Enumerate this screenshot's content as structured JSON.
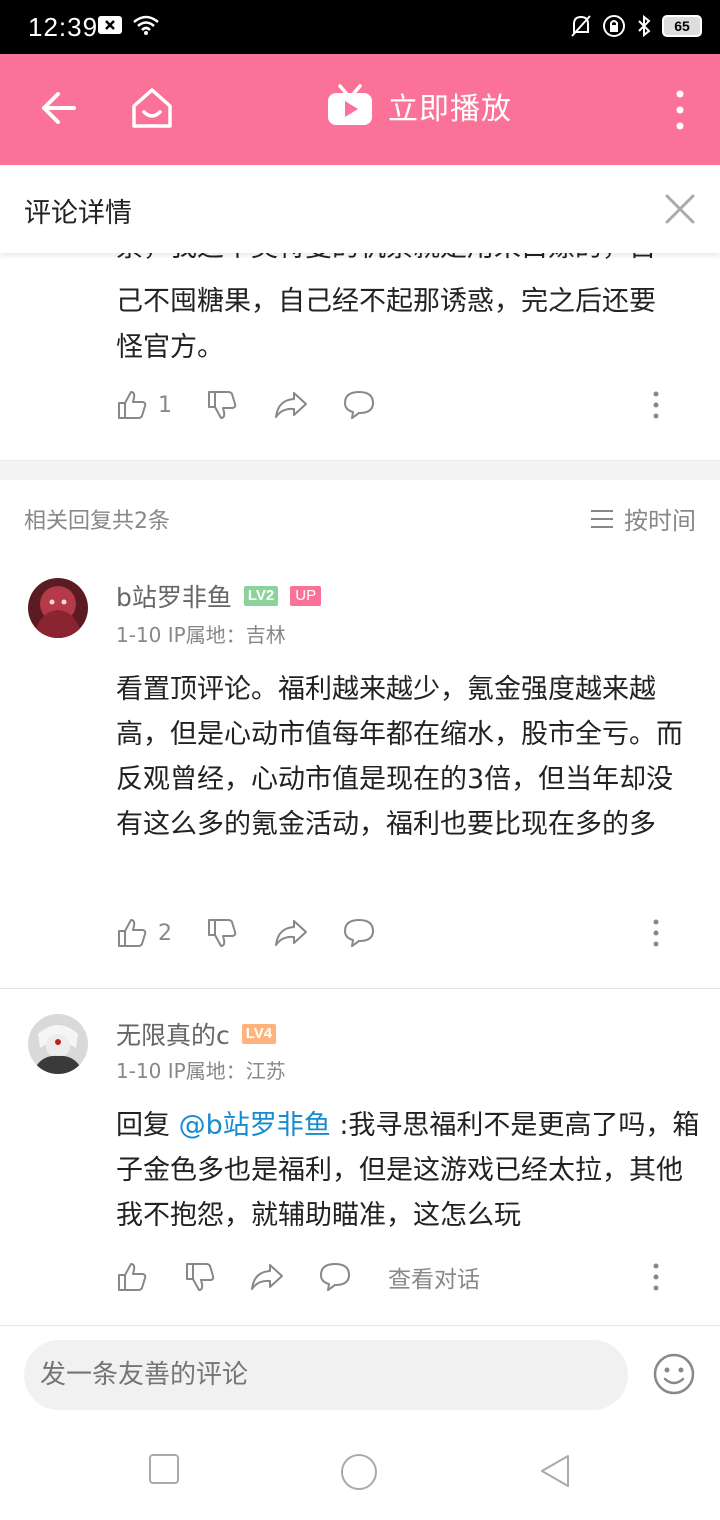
{
  "status_bar": {
    "time": "12:39",
    "battery": "65"
  },
  "top_bar": {
    "play_label": "立即播放",
    "accent_color": "#fb7299"
  },
  "detail_header": {
    "title": "评论详情"
  },
  "root_comment": {
    "text_line1": "己不囤糖果，自己经不起那诱惑，完之后还要",
    "text_line2": "怪官方。",
    "partial_top": "票，我这个奥特曼的机票就是用来白嫖的，自",
    "likes": "1"
  },
  "replies_header": {
    "count_label": "相关回复共2条",
    "sort_label": "按时间"
  },
  "replies": [
    {
      "username": "b站罗非鱼",
      "level": "LV2",
      "badge": "UP",
      "meta": "1-10  IP属地：吉林",
      "text": "看置顶评论。福利越来越少，氪金强度越来越高，但是心动市值每年都在缩水，股市全亏。而反观曾经，心动市值是现在的3倍，但当年却没有这么多的氪金活动，福利也要比现在多的多",
      "likes": "2"
    },
    {
      "username": "无限真的c",
      "level": "LV4",
      "meta": "1-10  IP属地：江苏",
      "reply_prefix": "回复 ",
      "mention": "@b站罗非鱼",
      "text": " :我寻思福利不是更高了吗，箱子金色多也是福利，但是这游戏已经太拉，其他我不抱怨，就辅助瞄准，这怎么玩",
      "view_dialog": "查看对话"
    }
  ],
  "comment_input": {
    "placeholder": "发一条友善的评论"
  },
  "colors": {
    "lv2": "#8bd29b",
    "lv4": "#ffb37c",
    "mention": "#178bcf"
  }
}
